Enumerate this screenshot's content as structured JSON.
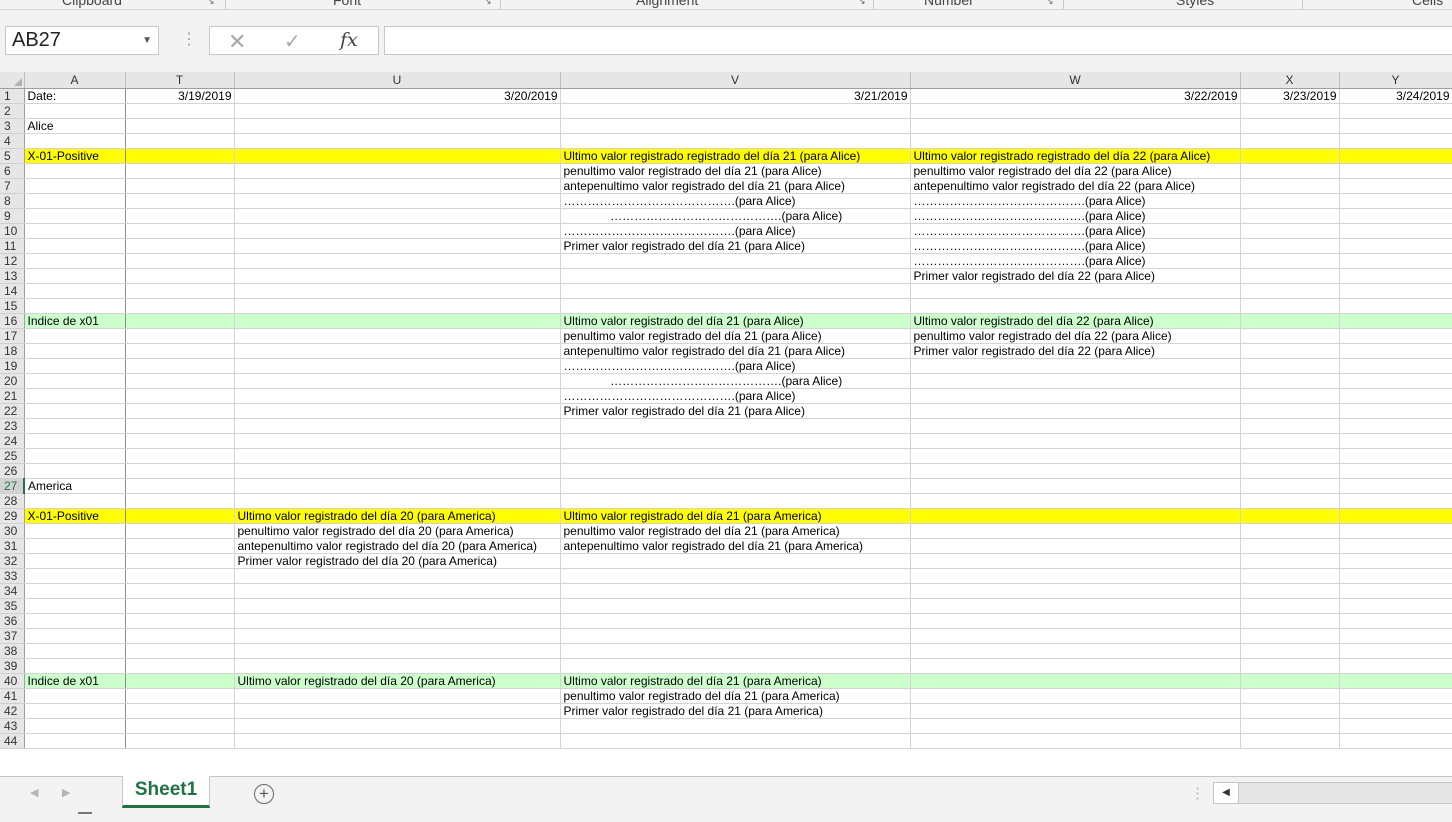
{
  "ribbon": {
    "groups": [
      "Clipboard",
      "Font",
      "Alignment",
      "Number",
      "Styles",
      "Cells"
    ]
  },
  "formula_bar": {
    "name_box": "AB27",
    "formula": "",
    "icons": [
      "cancel-icon",
      "enter-icon",
      "fx-icon"
    ],
    "fx_label": "fx"
  },
  "columns": [
    "A",
    "T",
    "U",
    "V",
    "W",
    "X",
    "Y"
  ],
  "rows": [
    {
      "n": "1",
      "cells": {
        "A": "Date:",
        "T": "3/19/2019",
        "U": "3/20/2019",
        "V": "3/21/2019",
        "W": "3/22/2019",
        "X": "3/23/2019",
        "Y": "3/24/2019"
      }
    },
    {
      "n": "2",
      "cells": {}
    },
    {
      "n": "3",
      "cells": {
        "A": "Alice"
      }
    },
    {
      "n": "4",
      "cells": {}
    },
    {
      "n": "5",
      "fill": "yellow",
      "cells": {
        "A": "X-01-Positive",
        "V": "Ultimo valor registrado registrado del día 21 (para Alice)",
        "W": "Ultimo valor registrado registrado del día 22 (para Alice)"
      }
    },
    {
      "n": "6",
      "cells": {
        "V": "penultimo valor registrado del día 21 (para Alice)",
        "W": "penultimo valor registrado del día 22 (para Alice)"
      }
    },
    {
      "n": "7",
      "cells": {
        "V": "antepenultimo valor registrado  del día 21 (para Alice)",
        "W": "antepenultimo valor registrado del día 22 (para Alice)"
      }
    },
    {
      "n": "8",
      "cells": {
        "V": "…………………………………….(para Alice)",
        "W": "…………………………………….(para Alice)"
      }
    },
    {
      "n": "9",
      "cells": {
        "V": "              …………………………………….(para Alice)",
        "W": "…………………………………….(para Alice)"
      }
    },
    {
      "n": "10",
      "cells": {
        "V": "…………………………………….(para Alice)",
        "W": "…………………………………….(para Alice)"
      }
    },
    {
      "n": "11",
      "cells": {
        "V": "Primer valor registrado  del día 21 (para Alice)",
        "W": "…………………………………….(para Alice)"
      }
    },
    {
      "n": "12",
      "cells": {
        "W": "…………………………………….(para Alice)"
      }
    },
    {
      "n": "13",
      "cells": {
        "W": "Primer valor registrado del día 22 (para Alice)"
      }
    },
    {
      "n": "14",
      "cells": {}
    },
    {
      "n": "15",
      "cells": {}
    },
    {
      "n": "16",
      "fill": "green",
      "cells": {
        "A": "Indice de x01",
        "V": "Ultimo valor registrado del día 21 (para Alice)",
        "W": "Ultimo valor registrado del día 22 (para Alice)"
      }
    },
    {
      "n": "17",
      "cells": {
        "V": "penultimo valor registrado del día 21 (para Alice)",
        "W": "penultimo valor registrado del día 22 (para Alice)"
      }
    },
    {
      "n": "18",
      "cells": {
        "V": "antepenultimo valor registrado del día 21 (para Alice)",
        "W": "Primer valor registrado del día 22 (para Alice)"
      }
    },
    {
      "n": "19",
      "cells": {
        "V": "…………………………………….(para Alice)"
      }
    },
    {
      "n": "20",
      "cells": {
        "V": "              …………………………………….(para Alice)"
      }
    },
    {
      "n": "21",
      "cells": {
        "V": "…………………………………….(para Alice)"
      }
    },
    {
      "n": "22",
      "cells": {
        "V": "Primer valor registrado del día 21 (para Alice)"
      }
    },
    {
      "n": "23",
      "cells": {}
    },
    {
      "n": "24",
      "cells": {}
    },
    {
      "n": "25",
      "cells": {}
    },
    {
      "n": "26",
      "cells": {}
    },
    {
      "n": "27",
      "active": true,
      "cells": {
        "A": "America"
      }
    },
    {
      "n": "28",
      "cells": {}
    },
    {
      "n": "29",
      "fill": "yellow",
      "cells": {
        "A": "X-01-Positive",
        "U": "Ultimo valor registrado del día 20 (para America)",
        "V": "Ultimo valor registrado del día 21 (para America)"
      }
    },
    {
      "n": "30",
      "cells": {
        "U": "penultimo valor registrado del día 20 (para America)",
        "V": "penultimo valor registrado del día 21 (para America)"
      }
    },
    {
      "n": "31",
      "cells": {
        "U": "antepenultimo valor registrado del día 20 (para America)",
        "V": "antepenultimo valor registrado del día 21 (para America)"
      }
    },
    {
      "n": "32",
      "cells": {
        "U": "Primer valor registrado del día 20 (para America)"
      }
    },
    {
      "n": "33",
      "cells": {}
    },
    {
      "n": "34",
      "cells": {}
    },
    {
      "n": "35",
      "cells": {}
    },
    {
      "n": "36",
      "cells": {}
    },
    {
      "n": "37",
      "cells": {}
    },
    {
      "n": "38",
      "cells": {}
    },
    {
      "n": "39",
      "cells": {}
    },
    {
      "n": "40",
      "fill": "green",
      "cells": {
        "A": "Indice de x01",
        "U": "Ultimo valor registrado del día 20 (para America)",
        "V": "Ultimo valor registrado del día 21 (para America)"
      }
    },
    {
      "n": "41",
      "cells": {
        "V": "penultimo valor registrado del día 21 (para America)"
      }
    },
    {
      "n": "42",
      "cells": {
        "V": "Primer valor registrado del día 21 (para America)"
      }
    },
    {
      "n": "43",
      "cells": {}
    },
    {
      "n": "44",
      "cells": {}
    }
  ],
  "sheet_tabs": {
    "active": "Sheet1",
    "add_label": "+"
  },
  "colors": {
    "yellow_fill": "#ffff00",
    "green_fill": "#ccffcc",
    "excel_green": "#217346"
  }
}
